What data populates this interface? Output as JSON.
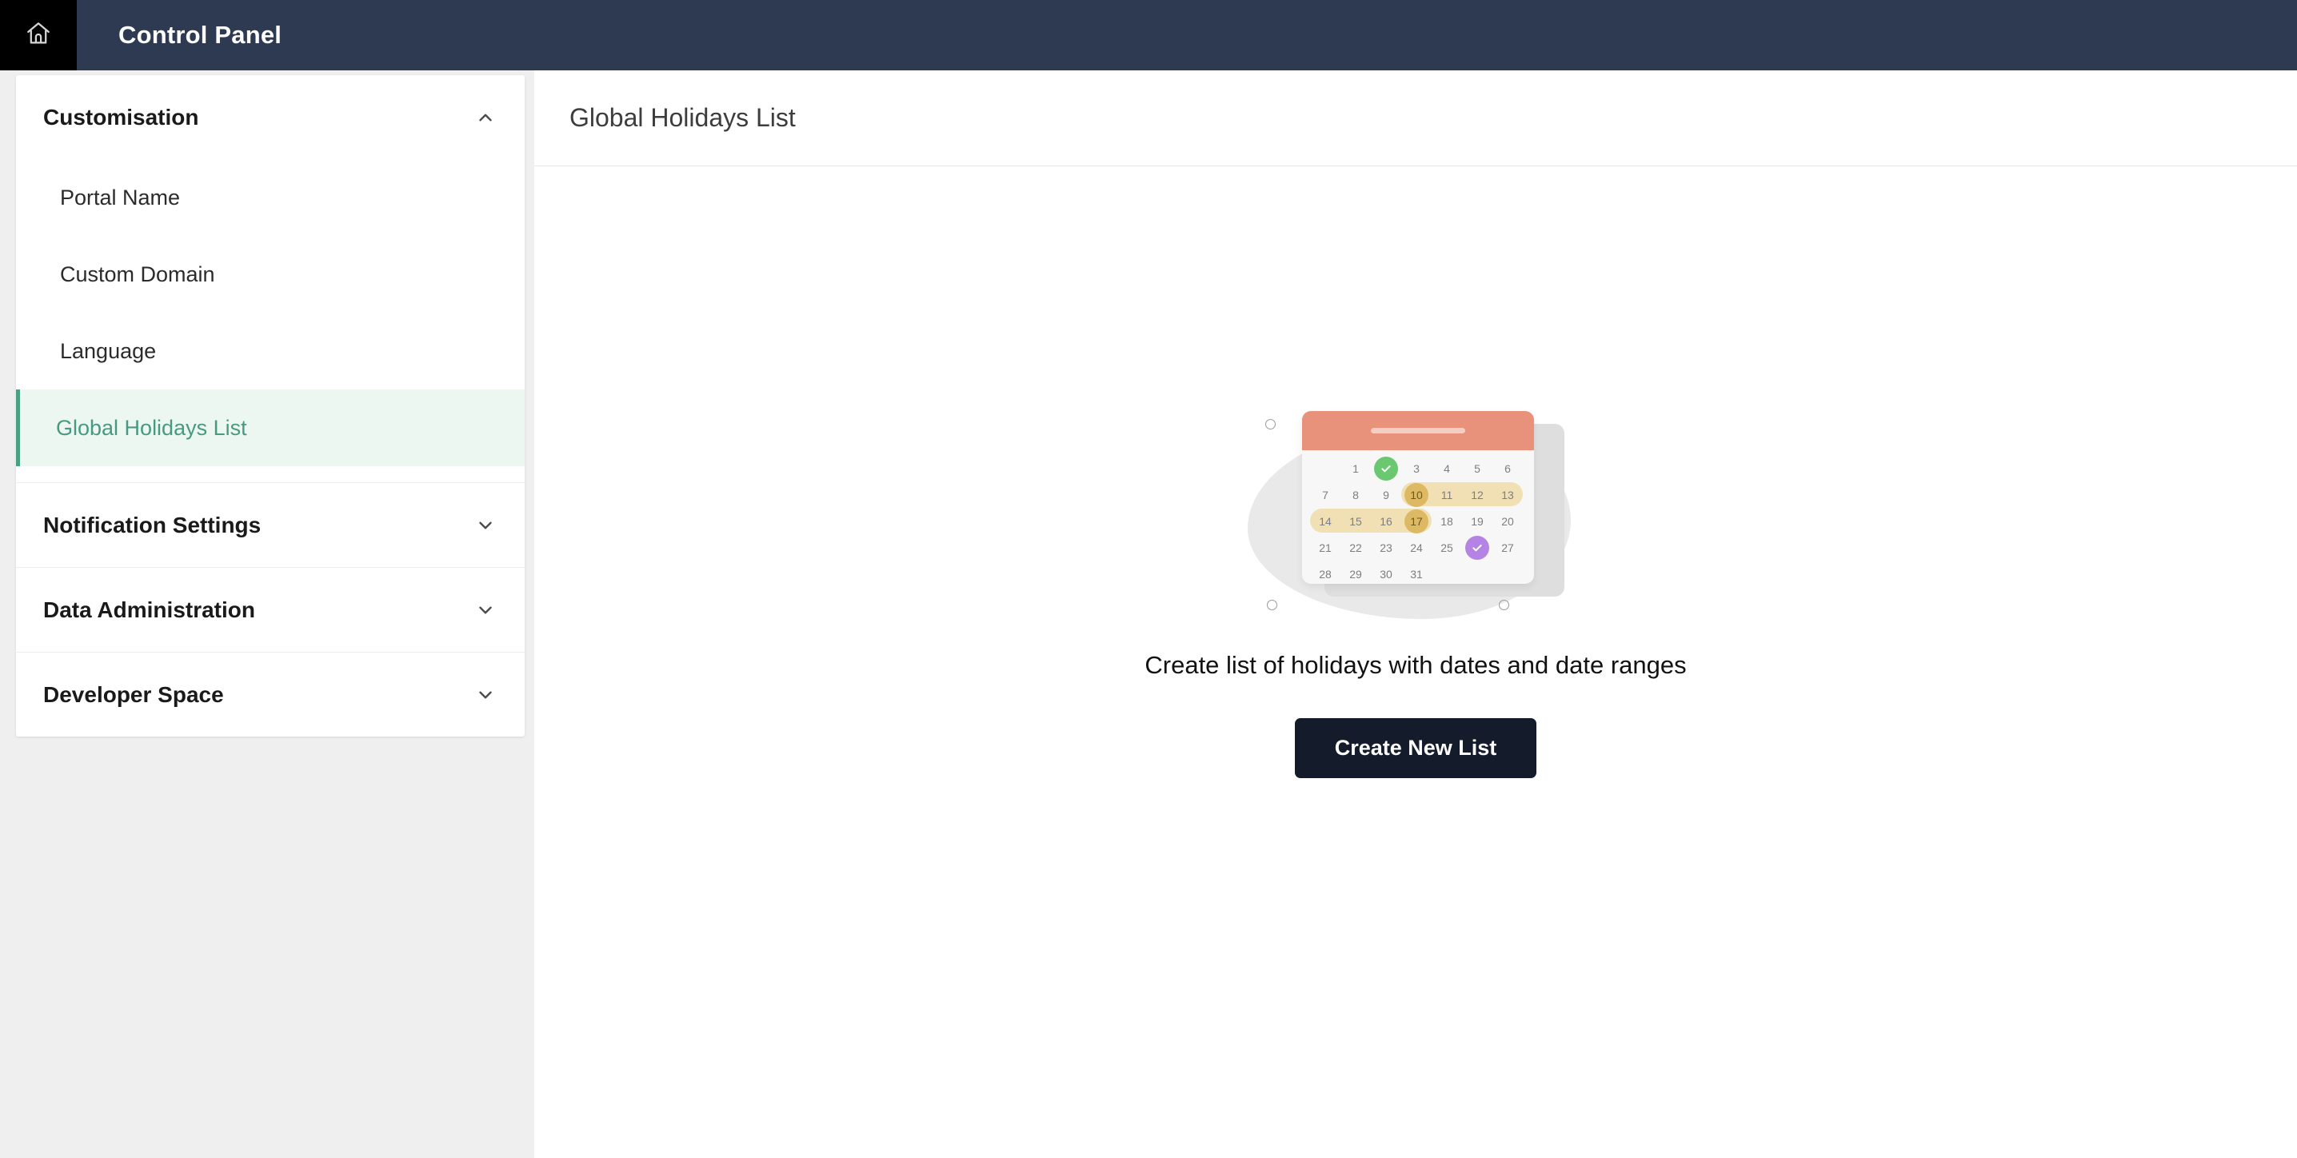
{
  "topbar": {
    "home_icon": "home-icon",
    "title": "Control Panel"
  },
  "sidebar": {
    "groups": [
      {
        "title": "Customisation",
        "expanded": true,
        "chevron": "chevron-up-icon",
        "items": [
          {
            "label": "Portal Name",
            "active": false
          },
          {
            "label": "Custom Domain",
            "active": false
          },
          {
            "label": "Language",
            "active": false
          },
          {
            "label": "Global Holidays List",
            "active": true
          }
        ]
      },
      {
        "title": "Notification Settings",
        "expanded": false,
        "chevron": "chevron-down-icon",
        "items": []
      },
      {
        "title": "Data Administration",
        "expanded": false,
        "chevron": "chevron-down-icon",
        "items": []
      },
      {
        "title": "Developer Space",
        "expanded": false,
        "chevron": "chevron-down-icon",
        "items": []
      }
    ]
  },
  "main": {
    "page_title": "Global Holidays List",
    "empty_state": {
      "caption": "Create list of holidays with dates and date ranges",
      "button_label": "Create New List",
      "illustration": {
        "name": "calendar-illustration",
        "header_color": "#e9927b",
        "rows": [
          [
            "",
            "1",
            "check-green",
            "3",
            "4",
            "5",
            "6"
          ],
          [
            "7",
            "8",
            "9",
            "10",
            "11",
            "12",
            "13"
          ],
          [
            "14",
            "15",
            "16",
            "17",
            "18",
            "19",
            "20"
          ],
          [
            "21",
            "22",
            "23",
            "24",
            "25",
            "check-purple",
            "27"
          ],
          [
            "28",
            "29",
            "30",
            "31",
            "",
            "",
            ""
          ]
        ],
        "highlight_dates": [
          "10",
          "17"
        ],
        "ranges": [
          {
            "from": "10",
            "to": "13"
          },
          {
            "from": "14",
            "to": "17"
          }
        ],
        "colors": {
          "green_check": "#6cc870",
          "purple_check": "#b583e3",
          "range_fill": "#f0e0b4",
          "date_dot": "#deb963"
        }
      }
    }
  },
  "theme": {
    "topbar_bg": "#2e3952",
    "accent_green": "#4aa083",
    "cta_bg": "#141b2b",
    "page_bg": "#efefef"
  }
}
